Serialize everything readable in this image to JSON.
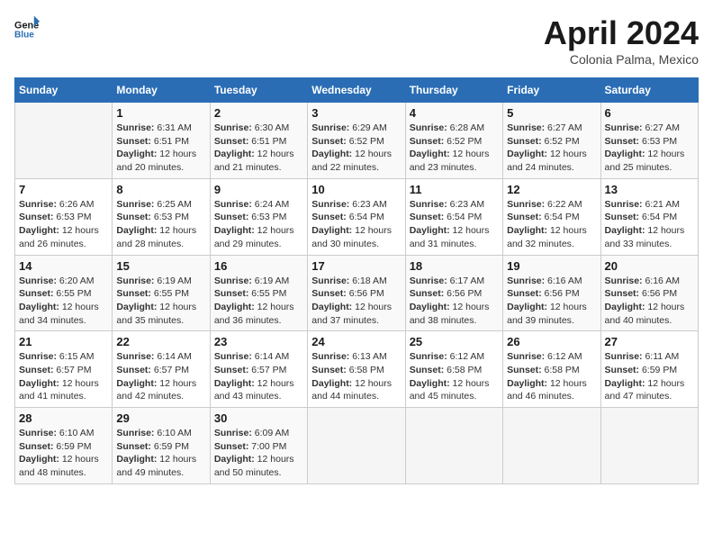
{
  "header": {
    "logo_line1": "General",
    "logo_line2": "Blue",
    "month_title": "April 2024",
    "subtitle": "Colonia Palma, Mexico"
  },
  "weekdays": [
    "Sunday",
    "Monday",
    "Tuesday",
    "Wednesday",
    "Thursday",
    "Friday",
    "Saturday"
  ],
  "weeks": [
    [
      {
        "day": "",
        "empty": true
      },
      {
        "day": "1",
        "sunrise": "6:31 AM",
        "sunset": "6:51 PM",
        "daylight": "12 hours and 20 minutes."
      },
      {
        "day": "2",
        "sunrise": "6:30 AM",
        "sunset": "6:51 PM",
        "daylight": "12 hours and 21 minutes."
      },
      {
        "day": "3",
        "sunrise": "6:29 AM",
        "sunset": "6:52 PM",
        "daylight": "12 hours and 22 minutes."
      },
      {
        "day": "4",
        "sunrise": "6:28 AM",
        "sunset": "6:52 PM",
        "daylight": "12 hours and 23 minutes."
      },
      {
        "day": "5",
        "sunrise": "6:27 AM",
        "sunset": "6:52 PM",
        "daylight": "12 hours and 24 minutes."
      },
      {
        "day": "6",
        "sunrise": "6:27 AM",
        "sunset": "6:53 PM",
        "daylight": "12 hours and 25 minutes."
      }
    ],
    [
      {
        "day": "7",
        "sunrise": "6:26 AM",
        "sunset": "6:53 PM",
        "daylight": "12 hours and 26 minutes."
      },
      {
        "day": "8",
        "sunrise": "6:25 AM",
        "sunset": "6:53 PM",
        "daylight": "12 hours and 28 minutes."
      },
      {
        "day": "9",
        "sunrise": "6:24 AM",
        "sunset": "6:53 PM",
        "daylight": "12 hours and 29 minutes."
      },
      {
        "day": "10",
        "sunrise": "6:23 AM",
        "sunset": "6:54 PM",
        "daylight": "12 hours and 30 minutes."
      },
      {
        "day": "11",
        "sunrise": "6:23 AM",
        "sunset": "6:54 PM",
        "daylight": "12 hours and 31 minutes."
      },
      {
        "day": "12",
        "sunrise": "6:22 AM",
        "sunset": "6:54 PM",
        "daylight": "12 hours and 32 minutes."
      },
      {
        "day": "13",
        "sunrise": "6:21 AM",
        "sunset": "6:54 PM",
        "daylight": "12 hours and 33 minutes."
      }
    ],
    [
      {
        "day": "14",
        "sunrise": "6:20 AM",
        "sunset": "6:55 PM",
        "daylight": "12 hours and 34 minutes."
      },
      {
        "day": "15",
        "sunrise": "6:19 AM",
        "sunset": "6:55 PM",
        "daylight": "12 hours and 35 minutes."
      },
      {
        "day": "16",
        "sunrise": "6:19 AM",
        "sunset": "6:55 PM",
        "daylight": "12 hours and 36 minutes."
      },
      {
        "day": "17",
        "sunrise": "6:18 AM",
        "sunset": "6:56 PM",
        "daylight": "12 hours and 37 minutes."
      },
      {
        "day": "18",
        "sunrise": "6:17 AM",
        "sunset": "6:56 PM",
        "daylight": "12 hours and 38 minutes."
      },
      {
        "day": "19",
        "sunrise": "6:16 AM",
        "sunset": "6:56 PM",
        "daylight": "12 hours and 39 minutes."
      },
      {
        "day": "20",
        "sunrise": "6:16 AM",
        "sunset": "6:56 PM",
        "daylight": "12 hours and 40 minutes."
      }
    ],
    [
      {
        "day": "21",
        "sunrise": "6:15 AM",
        "sunset": "6:57 PM",
        "daylight": "12 hours and 41 minutes."
      },
      {
        "day": "22",
        "sunrise": "6:14 AM",
        "sunset": "6:57 PM",
        "daylight": "12 hours and 42 minutes."
      },
      {
        "day": "23",
        "sunrise": "6:14 AM",
        "sunset": "6:57 PM",
        "daylight": "12 hours and 43 minutes."
      },
      {
        "day": "24",
        "sunrise": "6:13 AM",
        "sunset": "6:58 PM",
        "daylight": "12 hours and 44 minutes."
      },
      {
        "day": "25",
        "sunrise": "6:12 AM",
        "sunset": "6:58 PM",
        "daylight": "12 hours and 45 minutes."
      },
      {
        "day": "26",
        "sunrise": "6:12 AM",
        "sunset": "6:58 PM",
        "daylight": "12 hours and 46 minutes."
      },
      {
        "day": "27",
        "sunrise": "6:11 AM",
        "sunset": "6:59 PM",
        "daylight": "12 hours and 47 minutes."
      }
    ],
    [
      {
        "day": "28",
        "sunrise": "6:10 AM",
        "sunset": "6:59 PM",
        "daylight": "12 hours and 48 minutes."
      },
      {
        "day": "29",
        "sunrise": "6:10 AM",
        "sunset": "6:59 PM",
        "daylight": "12 hours and 49 minutes."
      },
      {
        "day": "30",
        "sunrise": "6:09 AM",
        "sunset": "7:00 PM",
        "daylight": "12 hours and 50 minutes."
      },
      {
        "day": "",
        "empty": true
      },
      {
        "day": "",
        "empty": true
      },
      {
        "day": "",
        "empty": true
      },
      {
        "day": "",
        "empty": true
      }
    ]
  ],
  "labels": {
    "sunrise": "Sunrise:",
    "sunset": "Sunset:",
    "daylight": "Daylight:"
  }
}
